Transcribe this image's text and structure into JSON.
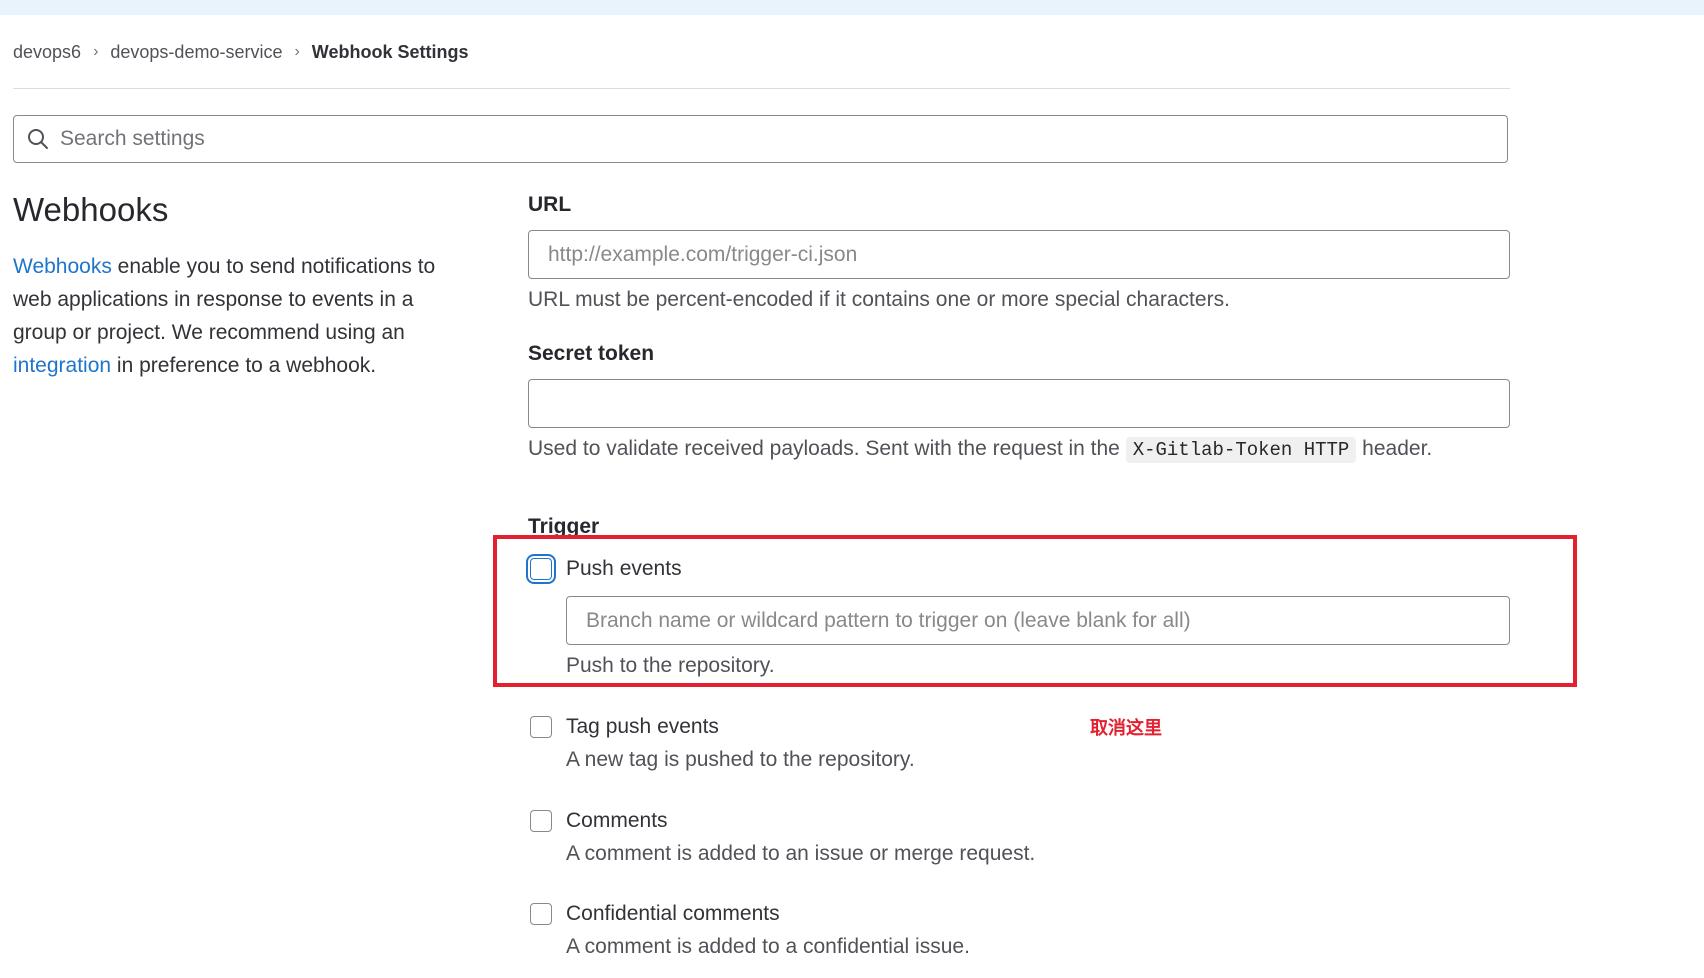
{
  "breadcrumb": {
    "items": [
      "devops6",
      "devops-demo-service"
    ],
    "current": "Webhook Settings"
  },
  "search": {
    "placeholder": "Search settings"
  },
  "sidebar": {
    "title": "Webhooks",
    "webhooks_link": "Webhooks",
    "text1": " enable you to send notifications to web applications in response to events in a group or project. We recommend using an ",
    "integration_link": "integration",
    "text2": " in preference to a webhook."
  },
  "form": {
    "url_label": "URL",
    "url_placeholder": "http://example.com/trigger-ci.json",
    "url_value": "",
    "url_help": "URL must be percent-encoded if it contains one or more special characters.",
    "secret_label": "Secret token",
    "secret_value": "",
    "secret_help_before": "Used to validate received payloads. Sent with the request in the ",
    "secret_help_code": "X-Gitlab-Token HTTP",
    "secret_help_after": " header.",
    "trigger_label": "Trigger"
  },
  "triggers": [
    {
      "label": "Push events",
      "checked": false,
      "help": "Push to the repository.",
      "branch_placeholder": "Branch name or wildcard pattern to trigger on (leave blank for all)"
    },
    {
      "label": "Tag push events",
      "checked": false,
      "help": "A new tag is pushed to the repository."
    },
    {
      "label": "Comments",
      "checked": false,
      "help": "A comment is added to an issue or merge request."
    },
    {
      "label": "Confidential comments",
      "checked": false,
      "help": "A comment is added to a confidential issue."
    }
  ],
  "annotation": {
    "text": "取消这里",
    "color": "#e3202f"
  },
  "colors": {
    "link": "#1f75cb",
    "accent_red": "#e3202f",
    "topbar": "#e9f3fc"
  }
}
